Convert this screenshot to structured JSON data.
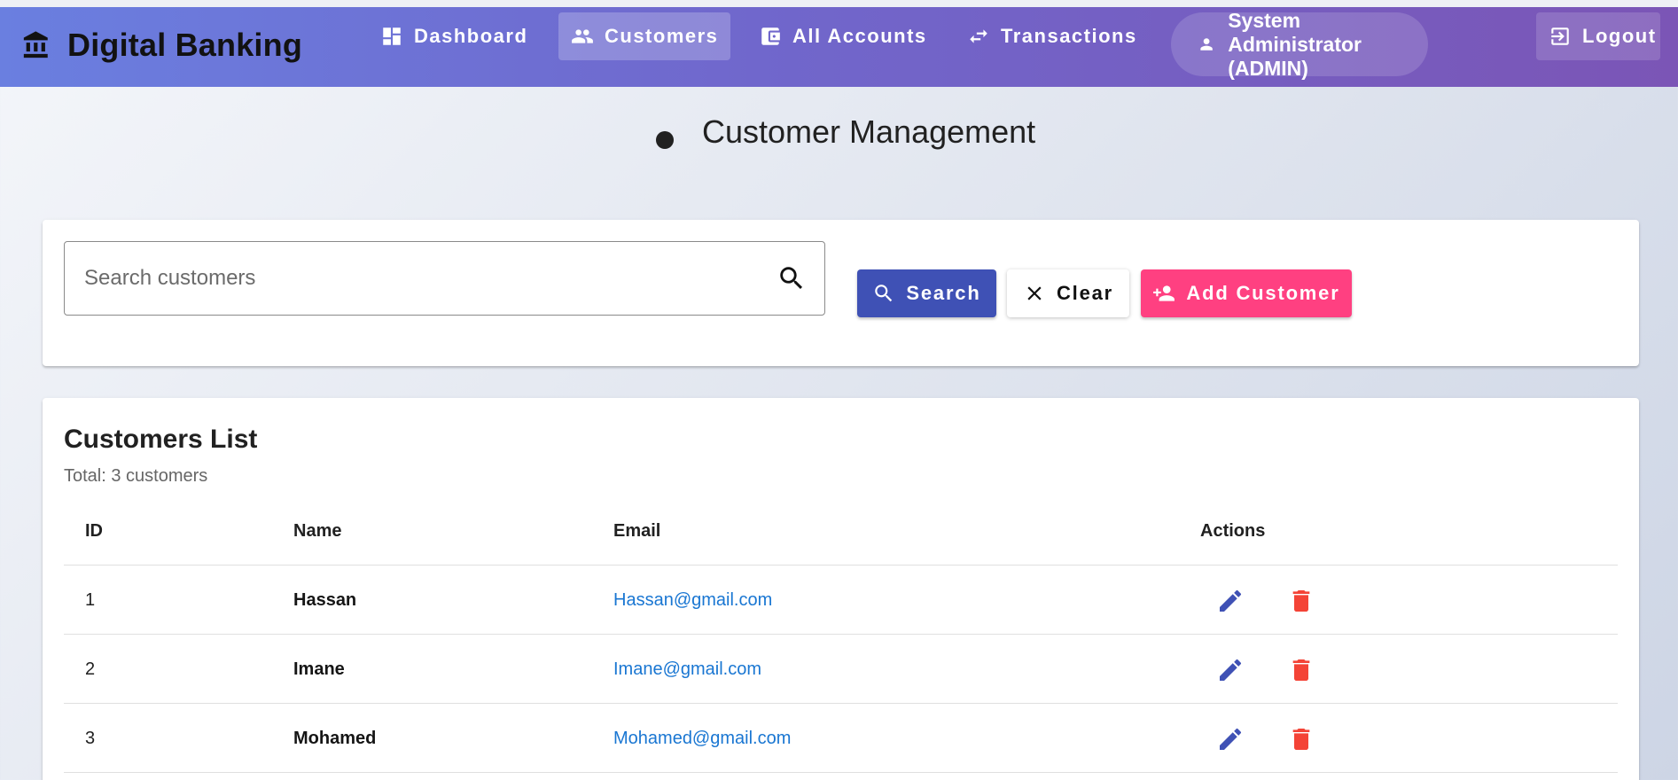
{
  "app": {
    "title": "Digital Banking"
  },
  "nav": [
    {
      "label": "Dashboard",
      "icon": "dashboard-icon",
      "active": false
    },
    {
      "label": "Customers",
      "icon": "people-icon",
      "active": true
    },
    {
      "label": "All Accounts",
      "icon": "wallet-icon",
      "active": false
    },
    {
      "label": "Transactions",
      "icon": "swap-icon",
      "active": false
    }
  ],
  "user": {
    "label": "System Administrator (ADMIN)",
    "icon": "person-icon"
  },
  "logout": {
    "label": "Logout",
    "icon": "logout-icon"
  },
  "page": {
    "title": "Customer Management"
  },
  "search": {
    "placeholder": "Search customers",
    "value": "",
    "search_label": "Search",
    "clear_label": "Clear",
    "add_label": "Add Customer"
  },
  "list": {
    "title": "Customers List",
    "total": "Total: 3 customers",
    "headers": {
      "id": "ID",
      "name": "Name",
      "email": "Email",
      "actions": "Actions"
    },
    "rows": [
      {
        "id": "1",
        "name": "Hassan",
        "email": "Hassan@gmail.com"
      },
      {
        "id": "2",
        "name": "Imane",
        "email": "Imane@gmail.com"
      },
      {
        "id": "3",
        "name": "Mohamed",
        "email": "Mohamed@gmail.com"
      }
    ]
  },
  "colors": {
    "primary": "#3f51b5",
    "accent": "#ff4081",
    "danger": "#f44336",
    "link": "#1976d2"
  }
}
